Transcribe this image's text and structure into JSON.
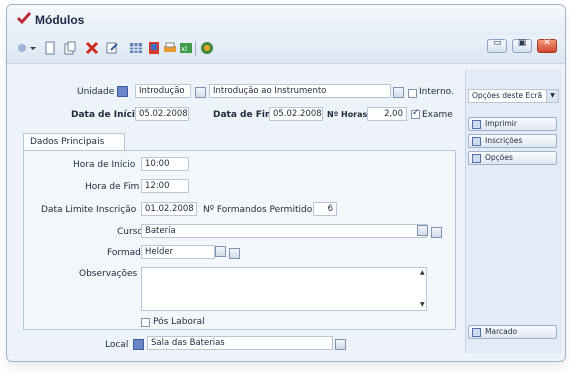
{
  "window": {
    "title": "Módulos"
  },
  "toolbar": {
    "icons": [
      "refresh-icon",
      "dropdown-icon",
      "new-icon",
      "copy-icon",
      "delete-icon",
      "edit-icon",
      "grid-icon",
      "report-icon",
      "print-icon",
      "export-icon",
      "help-icon"
    ]
  },
  "form": {
    "unidade_label": "Unidade",
    "unidade_code": "Introdução",
    "unidade_desc": "Introdução ao Instrumento",
    "interno_label": "Interno.",
    "data_inicio_label": "Data de Início",
    "data_inicio": "05.02.2008",
    "data_fim_label": "Data de Fim",
    "data_fim": "05.02.2008",
    "horas_label": "Nº Horas",
    "horas": "2,00",
    "exame_label": "Exame",
    "tab_label": "Dados Principais",
    "hora_inicio_label": "Hora de Início",
    "hora_inicio": "10:00",
    "hora_fim_label": "Hora de Fim",
    "hora_fim": "12:00",
    "limite_label": "Data Limite Inscrição",
    "limite": "01.02.2008",
    "formandos_label": "Nº Formandos Permitido",
    "formandos": "6",
    "curso_label": "Curso",
    "curso": "Bateria",
    "formador_label": "Formador",
    "formador": "Helder",
    "observacoes_label": "Observações",
    "pos_laboral_label": "Pós Laboral",
    "local_label": "Local",
    "local": "Sala das Baterias"
  },
  "sidebar": {
    "combo": "Opções deste Ecrã",
    "buttons": [
      "Imprimir",
      "Inscrições",
      "Opções"
    ],
    "bottom_button": "Marcado"
  }
}
